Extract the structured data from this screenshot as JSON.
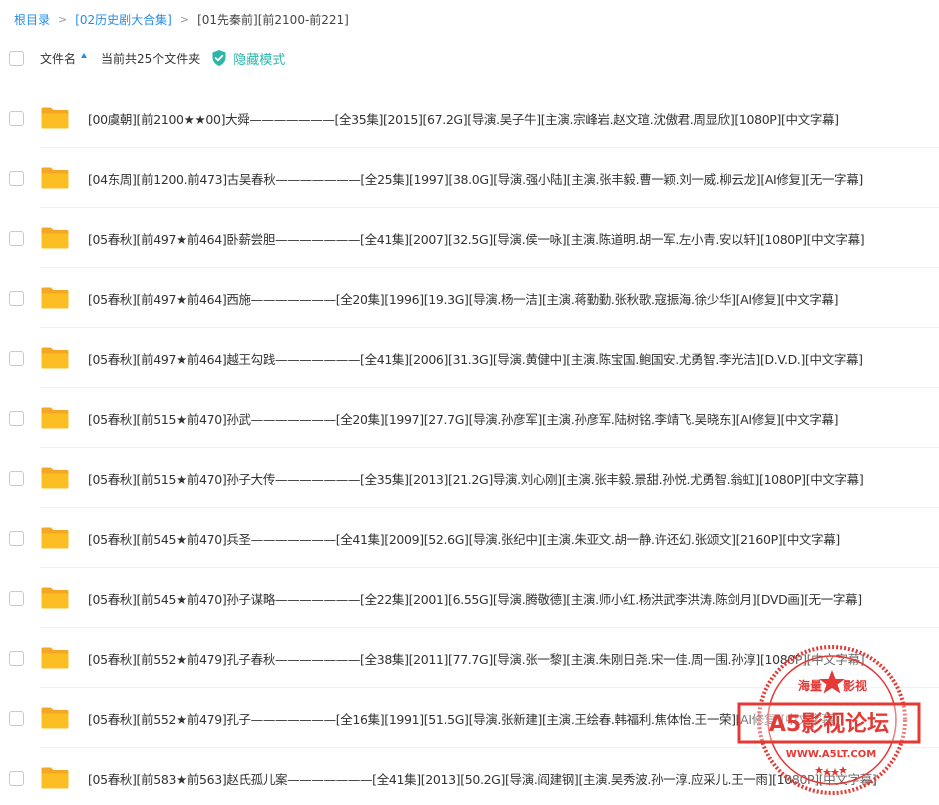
{
  "breadcrumb": {
    "root": "根目录",
    "level1": "[02历史剧大合集]",
    "current": "[01先秦前][前2100-前221]",
    "separator": ">"
  },
  "header": {
    "column_name": "文件名",
    "file_count": "当前共25个文件夹",
    "hide_mode": "隐藏模式"
  },
  "files": [
    "[00虞朝][前2100★★00]大舜———————[全35集][2015][67.2G][导演.吴子牛][主演.宗峰岩.赵文瑄.沈傲君.周显欣][1080P][中文字幕]",
    "[04东周][前1200.前473]古吴春秋———————[全25集][1997][38.0G][导演.强小陆][主演.张丰毅.曹一颖.刘一威.柳云龙][AI修复][无一字幕]",
    "[05春秋][前497★前464]卧薪尝胆———————[全41集][2007][32.5G][导演.侯一咏][主演.陈道明.胡一军.左小青.安以轩][1080P][中文字幕]",
    "[05春秋][前497★前464]西施———————[全20集][1996][19.3G][导演.杨一洁][主演.蒋勤勤.张秋歌.寇振海.徐少华][AI修复][中文字幕]",
    "[05春秋][前497★前464]越王勾践———————[全41集][2006][31.3G][导演.黄健中][主演.陈宝国.鲍国安.尤勇智.李光洁][D.V.D.][中文字幕]",
    "[05春秋][前515★前470]孙武———————[全20集][1997][27.7G][导演.孙彦军][主演.孙彦军.陆树铭.李靖飞.吴晓东][AI修复][中文字幕]",
    "[05春秋][前515★前470]孙子大传———————[全35集][2013][21.2G]导演.刘心刚][主演.张丰毅.景甜.孙悦.尤勇智.翁虹][1080P][中文字幕]",
    "[05春秋][前545★前470]兵圣———————[全41集][2009][52.6G][导演.张纪中][主演.朱亚文.胡一静.许还幻.张颂文][2160P][中文字幕]",
    "[05春秋][前545★前470]孙子谋略———————[全22集][2001][6.55G][导演.腾敬德][主演.师小红.杨洪武李洪涛.陈剑月][DVD画][无一字幕]",
    "[05春秋][前552★前479]孔子春秋———————[全38集][2011][77.7G][导演.张一黎][主演.朱刚日尧.宋一佳.周一围.孙淳][1080P][中文字幕]",
    "[05春秋][前552★前479]孔子———————[全16集][1991][51.5G][导演.张新建][主演.王绘春.韩福利.焦体怡.王一荣][AI修复][中文字幕]",
    "[05春秋][前583★前563]赵氏孤儿案———————[全41集][2013][50.2G][导演.阎建钢][主演.吴秀波.孙一淳.应采儿.王一雨][1080P][中文字幕]"
  ],
  "watermark": {
    "top_left": "海量",
    "top_right": "影视",
    "title": "A5影视论坛",
    "url": "WWW.A5LT.COM",
    "color": "#e53935"
  },
  "colors": {
    "link": "#2a8ce5",
    "accent_teal": "#2db6a8",
    "folder": "#fbbf24"
  }
}
